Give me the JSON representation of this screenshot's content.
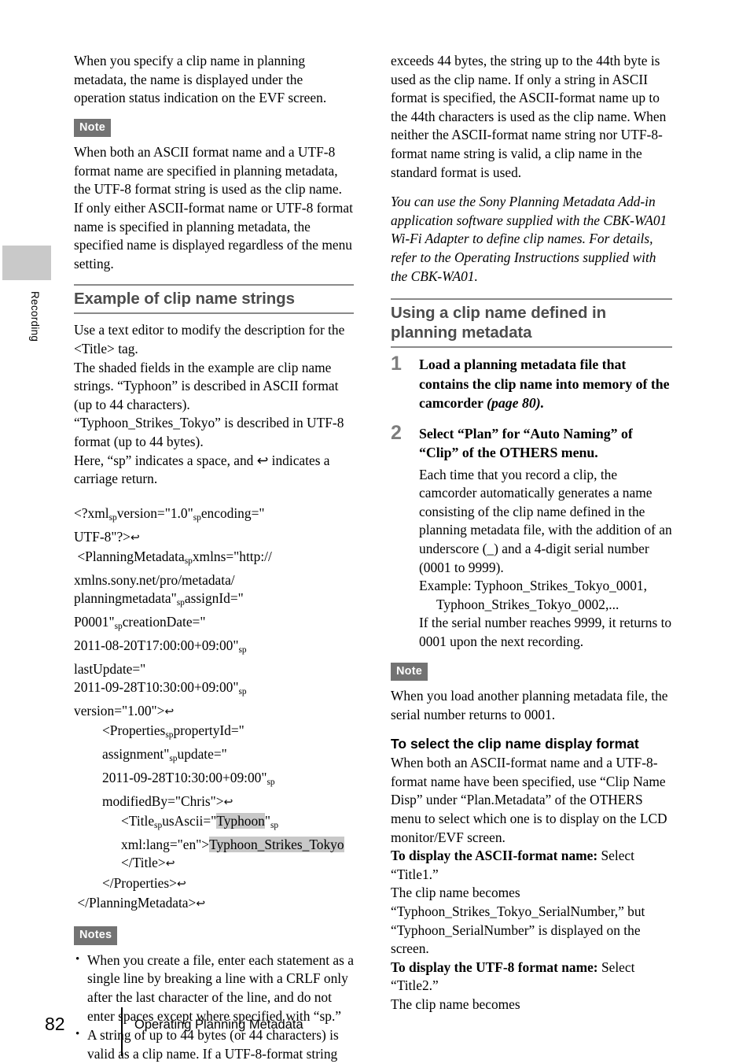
{
  "sidebar": {
    "tab_label": "Recording"
  },
  "footer": {
    "page_number": "82",
    "title": "Operating Planning Metadata"
  },
  "left_column": {
    "intro_paragraph": "When you specify a clip name in planning metadata, the name is displayed under the operation status indication on the EVF screen.",
    "note_badge": "Note",
    "note_paragraph": "When both an ASCII format name and a UTF-8 format name are specified in planning metadata, the UTF-8 format string is used as the clip name. If only either ASCII-format name or UTF-8 format name is specified in planning metadata, the specified name is displayed regardless of the menu setting.",
    "heading": "Example of clip name strings",
    "body_paragraph": "Use a text editor to modify the description for the <Title> tag.\nThe shaded fields in the example are clip name strings. “Typhoon” is described in ASCII format (up to 44 characters).\n“Typhoon_Strikes_Tokyo” is described in UTF-8 format (up to 44 bytes).\nHere, “sp” indicates a space, and ↵ indicates a carriage return.",
    "body_lines": [
      "Use a text editor to modify the description for the <Title> tag.",
      "The shaded fields in the example are clip name strings. “Typhoon” is described in ASCII format (up to 44 characters).",
      "“Typhoon_Strikes_Tokyo” is described in UTF-8 format (up to 44 bytes).",
      "Here, “sp” indicates a space, and ↩ indicates a carriage return."
    ],
    "notes_badge": "Notes",
    "notes_items": [
      "When you create a file, enter each statement as a single line by breaking a line with a CRLF only after the last character of the line, and do not enter spaces except where specified with “sp.”",
      "A string of up to 44 bytes (or 44 characters) is valid as a clip name. If a UTF-8-format string"
    ]
  },
  "xml_example": {
    "highlight_color": "#c8c8c8",
    "subscript_marker": "sp",
    "carriage_return_glyph": "↩",
    "lines": [
      {
        "indent": 0,
        "text": "<?xml[sp]version=\"1.0\"[sp]encoding=\""
      },
      {
        "indent": 0,
        "text": "UTF-8\"?>[cr]"
      },
      {
        "indent": 0,
        "text": " <PlanningMetadata[sp]xmlns=\"http://"
      },
      {
        "indent": 0,
        "text": "xmlns.sony.net/pro/metadata/"
      },
      {
        "indent": 0,
        "text": "planningmetadata\"[sp]assignId=\""
      },
      {
        "indent": 0,
        "text": "P0001\"[sp]creationDate=\""
      },
      {
        "indent": 0,
        "text": "2011-08-20T17:00:00+09:00\"[sp]"
      },
      {
        "indent": 0,
        "text": "lastUpdate=\""
      },
      {
        "indent": 0,
        "text": "2011-09-28T10:30:00+09:00\"[sp]"
      },
      {
        "indent": 0,
        "text": "version=\"1.00\">[cr]"
      },
      {
        "indent": 2,
        "text": "<Properties[sp]propertyId=\""
      },
      {
        "indent": 2,
        "text": "assignment\"[sp]update=\""
      },
      {
        "indent": 2,
        "text": "2011-09-28T10:30:00+09:00\"[sp]"
      },
      {
        "indent": 2,
        "text": "modifiedBy=\"Chris\">[cr]"
      },
      {
        "indent": 3,
        "text": "<Title[sp]usAscii=\"{Typhoon}\"[sp]"
      },
      {
        "indent": 3,
        "text": "xml:lang=\"en\">{Typhoon_Strikes_Tokyo}"
      },
      {
        "indent": 3,
        "text": "</Title>[cr]"
      },
      {
        "indent": 2,
        "text": "</Properties>[cr]"
      },
      {
        "indent": 0,
        "text": " </PlanningMetadata>[cr]"
      }
    ],
    "highlighted_values": [
      "Typhoon",
      "Typhoon_Strikes_Tokyo"
    ]
  },
  "right_column": {
    "continued_paragraph": "exceeds 44 bytes, the string up to the 44th byte is used as the clip name. If only a string in ASCII format is specified, the ASCII-format name up to the 44th characters is used as the clip name. When neither the ASCII-format name string nor UTF-8-format name string is valid, a clip name in the standard format is used.",
    "tip_paragraph": "You can use the Sony Planning Metadata Add-in application software supplied with the CBK-WA01 Wi-Fi Adapter to define clip names. For details, refer to the Operating Instructions supplied with the CBK-WA01.",
    "heading": "Using a clip name defined in planning metadata",
    "steps": [
      {
        "number": "1",
        "title": "Load a planning metadata file that contains the clip name into memory of the camcorder ",
        "title_page_ref": "(page 80).",
        "body_lines": []
      },
      {
        "number": "2",
        "title": "Select “Plan” for “Auto Naming” of “Clip” of the OTHERS menu.",
        "title_page_ref": "",
        "body_lines": [
          "Each time that you record a clip, the camcorder automatically generates a name consisting of the clip name defined in the planning metadata file, with the addition of an underscore (_) and a 4-digit serial number (0001 to 9999).",
          "Example: Typhoon_Strikes_Tokyo_0001,",
          "Typhoon_Strikes_Tokyo_0002,...",
          "If the serial number reaches 9999, it returns to 0001 upon the next recording."
        ]
      }
    ],
    "note_badge": "Note",
    "note_paragraph": "When you load another planning metadata file, the serial number returns to 0001.",
    "subhead": "To select the clip name display format",
    "subhead_paragraph": "When both an ASCII-format name and a UTF-8-format name have been specified, use “Clip Name Disp” under “Plan.Metadata” of the OTHERS menu to select which one is to display on the LCD monitor/EVF screen.",
    "ascii_label": "To display the ASCII-format name:",
    "ascii_value": " Select “Title1.”",
    "ascii_detail": "The clip name becomes “Typhoon_Strikes_Tokyo_SerialNumber,” but “Typhoon_SerialNumber” is displayed on the screen.",
    "utf8_label": "To display the UTF-8 format name:",
    "utf8_value": " Select “Title2.”",
    "utf8_detail": "The clip name becomes"
  }
}
